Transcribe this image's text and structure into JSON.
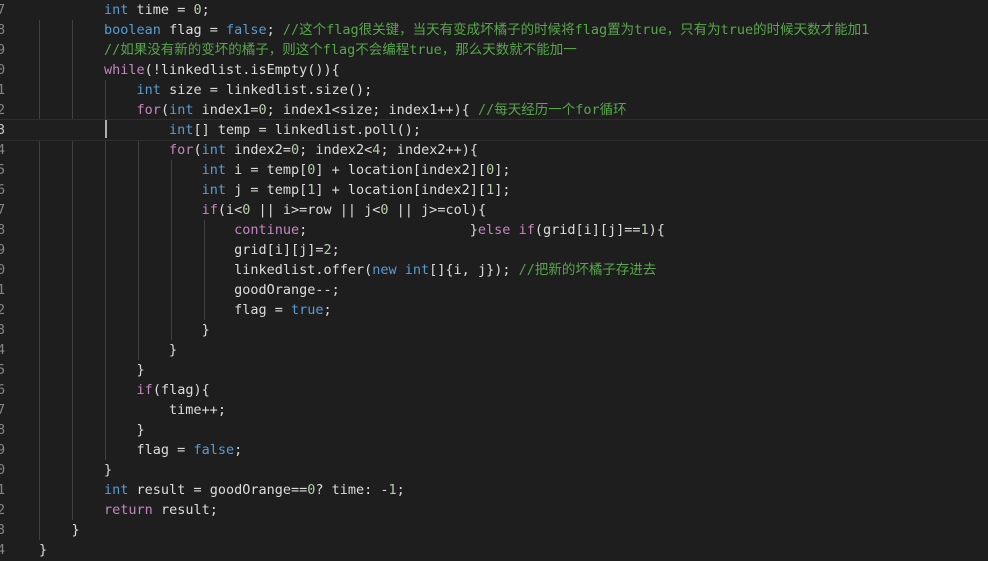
{
  "editor": {
    "lines": [
      {
        "num": "7",
        "tokens": [
          {
            "t": "        "
          },
          {
            "t": "int",
            "c": "kw"
          },
          {
            "t": " time = "
          },
          {
            "t": "0",
            "c": "num"
          },
          {
            "t": ";"
          }
        ]
      },
      {
        "num": "8",
        "tokens": [
          {
            "t": "        "
          },
          {
            "t": "boolean",
            "c": "kw"
          },
          {
            "t": " flag = "
          },
          {
            "t": "false",
            "c": "kw"
          },
          {
            "t": "; "
          },
          {
            "t": "//这个flag很关键，当天有变成坏橘子的时候将flag置为true，只有为true的时候天数才能加1",
            "c": "cm"
          }
        ]
      },
      {
        "num": "9",
        "tokens": [
          {
            "t": "        "
          },
          {
            "t": "//如果没有新的变坏的橘子，则这个flag不会编程true，那么天数就不能加一",
            "c": "cm"
          }
        ]
      },
      {
        "num": "0",
        "tokens": [
          {
            "t": "        "
          },
          {
            "t": "while",
            "c": "ctl"
          },
          {
            "t": "(!linkedlist.isEmpty()){"
          }
        ]
      },
      {
        "num": "1",
        "tokens": [
          {
            "t": "            "
          },
          {
            "t": "int",
            "c": "kw"
          },
          {
            "t": " size = linkedlist.size();"
          }
        ]
      },
      {
        "num": "2",
        "tokens": [
          {
            "t": "            "
          },
          {
            "t": "for",
            "c": "ctl"
          },
          {
            "t": "("
          },
          {
            "t": "int",
            "c": "kw"
          },
          {
            "t": " index1="
          },
          {
            "t": "0",
            "c": "num"
          },
          {
            "t": "; index1<size; index1++){ "
          },
          {
            "t": "//每天经历一个for循环",
            "c": "cm"
          }
        ]
      },
      {
        "num": "3",
        "current": true,
        "tokens": [
          {
            "t": "                "
          },
          {
            "t": "int",
            "c": "kw"
          },
          {
            "t": "[] temp = linkedlist.poll();"
          }
        ]
      },
      {
        "num": "4",
        "tokens": [
          {
            "t": "                "
          },
          {
            "t": "for",
            "c": "ctl"
          },
          {
            "t": "("
          },
          {
            "t": "int",
            "c": "kw"
          },
          {
            "t": " index2="
          },
          {
            "t": "0",
            "c": "num"
          },
          {
            "t": "; index2<"
          },
          {
            "t": "4",
            "c": "num"
          },
          {
            "t": "; index2++){"
          }
        ]
      },
      {
        "num": "5",
        "tokens": [
          {
            "t": "                    "
          },
          {
            "t": "int",
            "c": "kw"
          },
          {
            "t": " i = temp["
          },
          {
            "t": "0",
            "c": "num"
          },
          {
            "t": "] + location[index2]["
          },
          {
            "t": "0",
            "c": "num"
          },
          {
            "t": "];"
          }
        ]
      },
      {
        "num": "6",
        "tokens": [
          {
            "t": "                    "
          },
          {
            "t": "int",
            "c": "kw"
          },
          {
            "t": " j = temp["
          },
          {
            "t": "1",
            "c": "num"
          },
          {
            "t": "] + location[index2]["
          },
          {
            "t": "1",
            "c": "num"
          },
          {
            "t": "];"
          }
        ]
      },
      {
        "num": "7",
        "tokens": [
          {
            "t": "                    "
          },
          {
            "t": "if",
            "c": "ctl"
          },
          {
            "t": "(i<"
          },
          {
            "t": "0",
            "c": "num"
          },
          {
            "t": " || i>=row || j<"
          },
          {
            "t": "0",
            "c": "num"
          },
          {
            "t": " || j>=col){"
          }
        ]
      },
      {
        "num": "8",
        "tokens": [
          {
            "t": "                        "
          },
          {
            "t": "continue",
            "c": "ctl"
          },
          {
            "t": ";                    }"
          },
          {
            "t": "else",
            "c": "ctl"
          },
          {
            "t": " "
          },
          {
            "t": "if",
            "c": "ctl"
          },
          {
            "t": "(grid[i][j]=="
          },
          {
            "t": "1",
            "c": "num"
          },
          {
            "t": "){"
          }
        ]
      },
      {
        "num": "9",
        "tokens": [
          {
            "t": "                        "
          },
          {
            "t": "grid[i][j]="
          },
          {
            "t": "2",
            "c": "num"
          },
          {
            "t": ";"
          }
        ]
      },
      {
        "num": "0",
        "tokens": [
          {
            "t": "                        "
          },
          {
            "t": "linkedlist.offer("
          },
          {
            "t": "new",
            "c": "kw"
          },
          {
            "t": " "
          },
          {
            "t": "int",
            "c": "kw"
          },
          {
            "t": "[]{i, j}); "
          },
          {
            "t": "//把新的坏橘子存进去",
            "c": "cm"
          }
        ]
      },
      {
        "num": "1",
        "tokens": [
          {
            "t": "                        "
          },
          {
            "t": "goodOrange--;"
          }
        ]
      },
      {
        "num": "2",
        "tokens": [
          {
            "t": "                        "
          },
          {
            "t": "flag = "
          },
          {
            "t": "true",
            "c": "kw"
          },
          {
            "t": ";"
          }
        ]
      },
      {
        "num": "3",
        "tokens": [
          {
            "t": "                    "
          },
          {
            "t": "}"
          }
        ]
      },
      {
        "num": "4",
        "tokens": [
          {
            "t": "                "
          },
          {
            "t": "}"
          }
        ]
      },
      {
        "num": "5",
        "tokens": [
          {
            "t": "            "
          },
          {
            "t": "}"
          }
        ]
      },
      {
        "num": "6",
        "tokens": [
          {
            "t": "            "
          },
          {
            "t": "if",
            "c": "ctl"
          },
          {
            "t": "(flag){"
          }
        ]
      },
      {
        "num": "7",
        "tokens": [
          {
            "t": "                "
          },
          {
            "t": "time++;"
          }
        ]
      },
      {
        "num": "8",
        "tokens": [
          {
            "t": "            "
          },
          {
            "t": "}"
          }
        ]
      },
      {
        "num": "9",
        "tokens": [
          {
            "t": "            "
          },
          {
            "t": "flag = "
          },
          {
            "t": "false",
            "c": "kw"
          },
          {
            "t": ";"
          }
        ]
      },
      {
        "num": "0",
        "tokens": [
          {
            "t": "        "
          },
          {
            "t": "}"
          }
        ]
      },
      {
        "num": "1",
        "tokens": [
          {
            "t": "        "
          },
          {
            "t": "int",
            "c": "kw"
          },
          {
            "t": " result = goodOrange=="
          },
          {
            "t": "0",
            "c": "num"
          },
          {
            "t": "? time: -"
          },
          {
            "t": "1",
            "c": "num"
          },
          {
            "t": ";"
          }
        ]
      },
      {
        "num": "2",
        "tokens": [
          {
            "t": "        "
          },
          {
            "t": "return",
            "c": "ctl"
          },
          {
            "t": " result;"
          }
        ]
      },
      {
        "num": "3",
        "tokens": [
          {
            "t": "    "
          },
          {
            "t": "}"
          }
        ]
      },
      {
        "num": "4",
        "tokens": [
          {
            "t": "}"
          }
        ]
      }
    ]
  },
  "colors": {
    "background": "#1e1e1e",
    "keyword": "#569cd6",
    "control": "#c586c0",
    "number": "#b5cea8",
    "comment": "#57a64a",
    "text": "#dcdcdc",
    "line_number": "#858585"
  }
}
